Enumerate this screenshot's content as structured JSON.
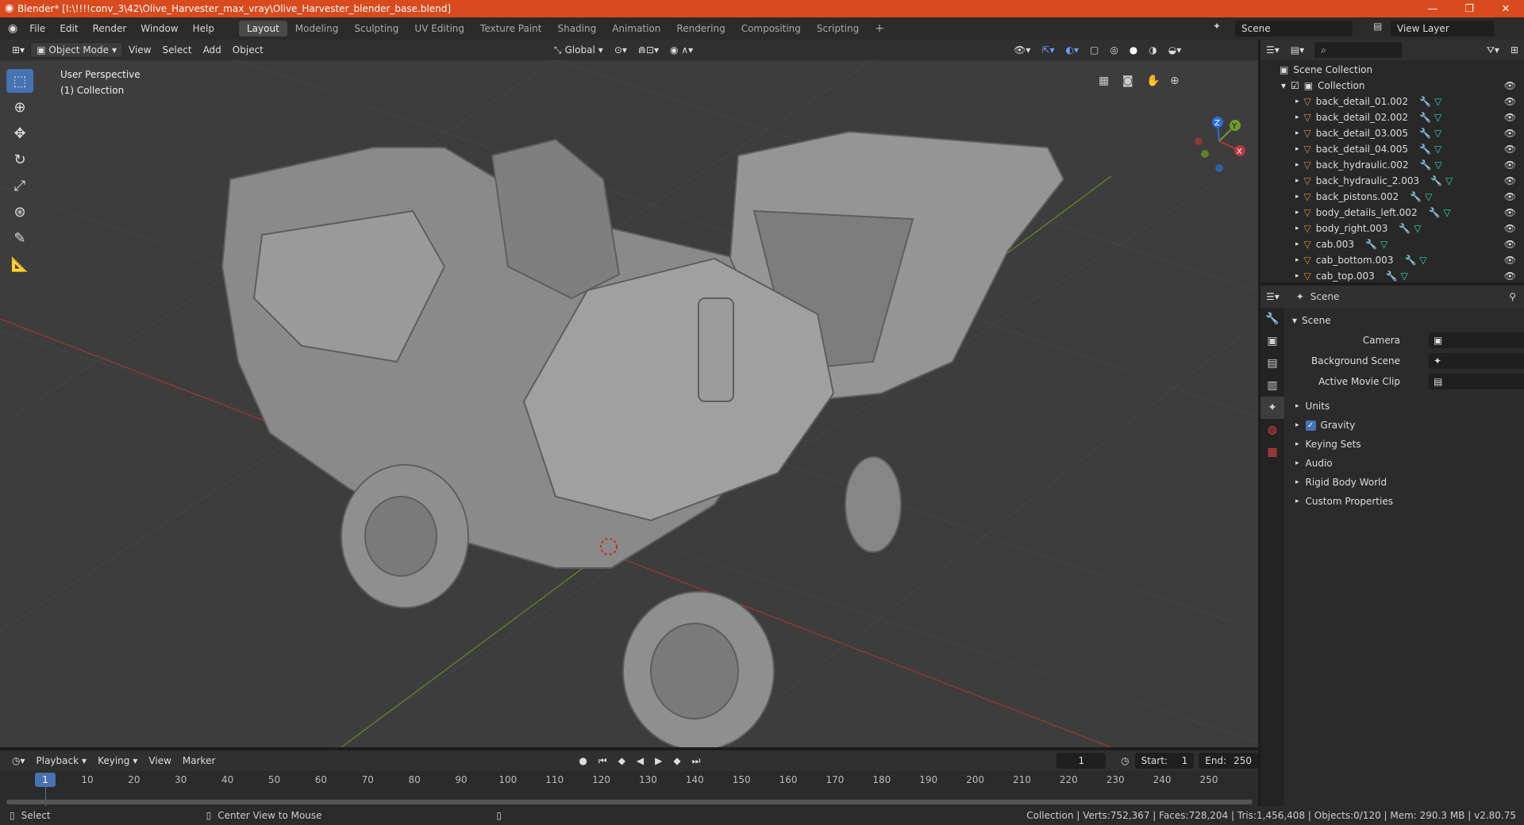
{
  "window": {
    "title": "Blender* [I:\\!!!!conv_3\\42\\Olive_Harvester_max_vray\\Olive_Harvester_blender_base.blend]",
    "minimize": "—",
    "maximize": "❐",
    "close": "✕"
  },
  "menu": [
    "File",
    "Edit",
    "Render",
    "Window",
    "Help"
  ],
  "workspaces": [
    "Layout",
    "Modeling",
    "Sculpting",
    "UV Editing",
    "Texture Paint",
    "Shading",
    "Animation",
    "Rendering",
    "Compositing",
    "Scripting"
  ],
  "active_workspace": "Layout",
  "scene_selector": "Scene",
  "view_layer_selector": "View Layer",
  "viewport_header": {
    "mode": "Object Mode",
    "menus": [
      "View",
      "Select",
      "Add",
      "Object"
    ],
    "orientation": "Global"
  },
  "viewport": {
    "perspective": "User Perspective",
    "collection": "(1) Collection",
    "gizmo_x": "X",
    "gizmo_y": "Y",
    "gizmo_z": "Z"
  },
  "outliner": {
    "root": "Scene Collection",
    "collection": "Collection",
    "items": [
      "back_detail_01.002",
      "back_detail_02.002",
      "back_detail_03.005",
      "back_detail_04.005",
      "back_hydraulic.002",
      "back_hydraulic_2.003",
      "back_pistons.002",
      "body_details_left.002",
      "body_right.003",
      "cab.003",
      "cab_bottom.003",
      "cab_top.003"
    ]
  },
  "properties": {
    "header": "Scene",
    "section": "Scene",
    "fields": [
      {
        "label": "Camera",
        "value": ""
      },
      {
        "label": "Background Scene",
        "value": ""
      },
      {
        "label": "Active Movie Clip",
        "value": ""
      }
    ],
    "subpanels": [
      "Units",
      "Gravity",
      "Keying Sets",
      "Audio",
      "Rigid Body World",
      "Custom Properties"
    ],
    "gravity_checked": true
  },
  "timeline": {
    "menus": [
      "Playback",
      "Keying",
      "View",
      "Marker"
    ],
    "current_frame": "1",
    "start_label": "Start:",
    "start": "1",
    "end_label": "End:",
    "end": "250",
    "ticks": [
      "1",
      "10",
      "20",
      "30",
      "40",
      "50",
      "60",
      "70",
      "80",
      "90",
      "100",
      "110",
      "120",
      "130",
      "140",
      "150",
      "160",
      "170",
      "180",
      "190",
      "200",
      "210",
      "220",
      "230",
      "240",
      "250"
    ]
  },
  "status": {
    "left_action": "Select",
    "mid_action": "Center View to Mouse",
    "stats": "Collection | Verts:752,367 | Faces:728,204 | Tris:1,456,408 | Objects:0/120 | Mem: 290.3 MB | v2.80.75"
  },
  "colors": {
    "titlebar": "#d94a1e",
    "accent": "#4772b3",
    "x_axis": "#b8383f",
    "y_axis": "#6d9a29",
    "z_axis": "#2b6fd6"
  }
}
